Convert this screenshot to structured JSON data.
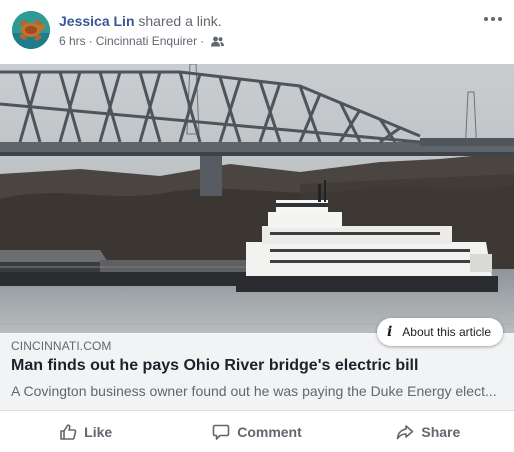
{
  "post": {
    "author": "Jessica Lin",
    "action": "shared a link.",
    "time": "6 hrs",
    "source": "Cincinnati Enquirer",
    "audience_icon": "friends-icon",
    "more_icon": "more-horizontal-icon"
  },
  "link": {
    "domain": "CINCINNATI.COM",
    "title": "Man finds out he pays Ohio River bridge's electric bill",
    "description": "A Covington business owner found out he was paying the Duke Energy elect...",
    "about_label": "About this article",
    "about_icon": "info-icon"
  },
  "actions": {
    "like": "Like",
    "comment": "Comment",
    "share": "Share"
  },
  "colors": {
    "author": "#385898",
    "secondary_text": "#606770",
    "link_box_bg": "#f2f3f5"
  }
}
